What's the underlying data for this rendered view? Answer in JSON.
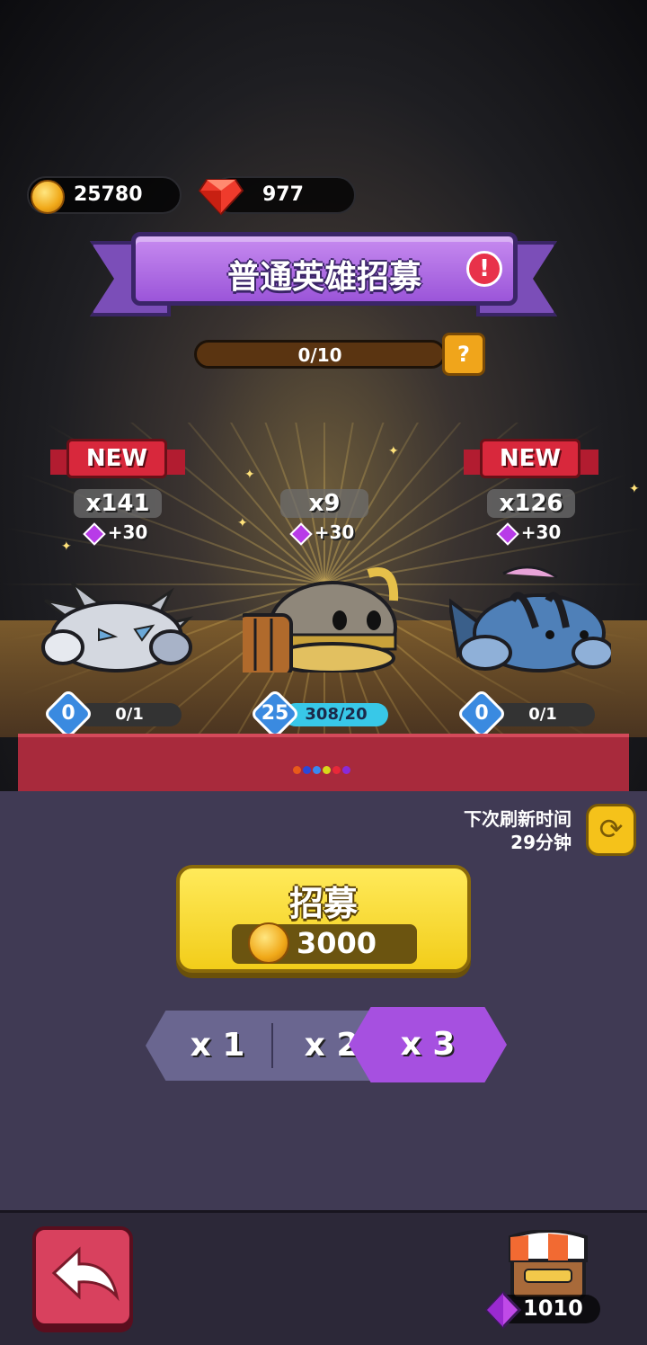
{
  "currency": {
    "coins": "25780",
    "rubies": "977",
    "coin_icon": "gold-coin-icon",
    "ruby_icon": "red-ruby-icon"
  },
  "banner": {
    "title": "普通英雄招募",
    "alert_icon": "exclamation-icon"
  },
  "progress": {
    "text": "0/10",
    "value": 0.0,
    "help_icon": "question-mark-icon"
  },
  "heroes": [
    {
      "new_tag": "NEW",
      "count": "x141",
      "bonus": "+30",
      "level": "0",
      "progress": "0/1",
      "fill": 0.0
    },
    {
      "new_tag": "",
      "count": "x9",
      "bonus": "+30",
      "level": "25",
      "progress": "308/20",
      "fill": 1.0
    },
    {
      "new_tag": "NEW",
      "count": "x126",
      "bonus": "+30",
      "level": "0",
      "progress": "0/1",
      "fill": 0.0
    }
  ],
  "refresh": {
    "label": "下次刷新时间",
    "time": "29分钟",
    "icon": "refresh-icon"
  },
  "recruit": {
    "label": "招募",
    "cost": "3000",
    "cost_icon": "gold-coin-icon"
  },
  "multipliers": [
    {
      "label": "x 1",
      "selected": false
    },
    {
      "label": "x 2",
      "selected": false
    },
    {
      "label": "x 3",
      "selected": true
    }
  ],
  "footer": {
    "back_icon": "back-arrow-icon",
    "shop_icon": "shop-stall-icon",
    "gems": "1010",
    "gem_icon": "purple-gem-icon"
  },
  "colors": {
    "accent_purple": "#a650e0",
    "button_yellow": "#f5c21a",
    "back_red": "#d8415e",
    "panel": "#403a54"
  }
}
